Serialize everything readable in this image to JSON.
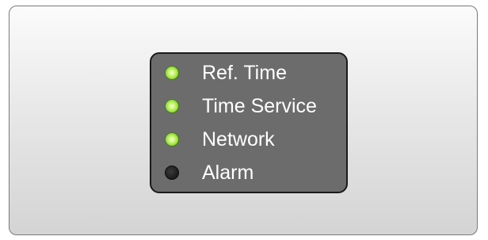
{
  "status_panel": {
    "indicators": [
      {
        "label": "Ref. Time",
        "state": "on",
        "color": "#a6e84a"
      },
      {
        "label": "Time Service",
        "state": "on",
        "color": "#a6e84a"
      },
      {
        "label": "Network",
        "state": "on",
        "color": "#a6e84a"
      },
      {
        "label": "Alarm",
        "state": "off",
        "color": "#1c1c1c"
      }
    ]
  }
}
